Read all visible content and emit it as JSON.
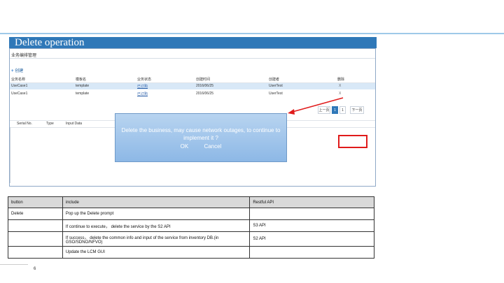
{
  "slide": {
    "title": "Delete operation",
    "page_number": "6"
  },
  "screenshot": {
    "window_title": "业务编排管理",
    "add_button": "创建",
    "columns": [
      "业务名称",
      "模板名",
      "业务状态",
      "创建时间",
      "创建者",
      "删除"
    ],
    "rows": [
      [
        "UseCase1",
        "template",
        "已订购",
        "2016/06/25",
        "UserTest",
        "X"
      ],
      [
        "UseCase1",
        "template",
        "已订购",
        "2016/06/25",
        "UserTest",
        "X"
      ]
    ],
    "pagination": {
      "prev": "上一页",
      "current": "1",
      "next_num": "1",
      "next": "下一页"
    },
    "sub_columns": [
      "Serial No.",
      "Type",
      "Input Data"
    ]
  },
  "dialog": {
    "message": "Delete the business, may cause network outages, to continue to implement it ?",
    "ok": "OK",
    "cancel": "Cancel"
  },
  "table": {
    "headers": {
      "button": "button",
      "include": "include",
      "api": "Restful API"
    },
    "rows": [
      {
        "button": "Delete",
        "include": "Pop up the Delete prompt",
        "api": ""
      },
      {
        "button": "",
        "include": "If continue to execute， delete the service by the S2 API",
        "api": "S3 API"
      },
      {
        "button": "",
        "include": "If success， delete the common info and input of the service from inventory DB.(in GSO/SDNO/NFVO)",
        "api": "S2 API"
      },
      {
        "button": "",
        "include": "Update the LCM GUI",
        "api": ""
      }
    ]
  },
  "colors": {
    "title_bar": "#2f78b8",
    "highlight": "#e01b1b",
    "dialog": "#8db8e6"
  }
}
